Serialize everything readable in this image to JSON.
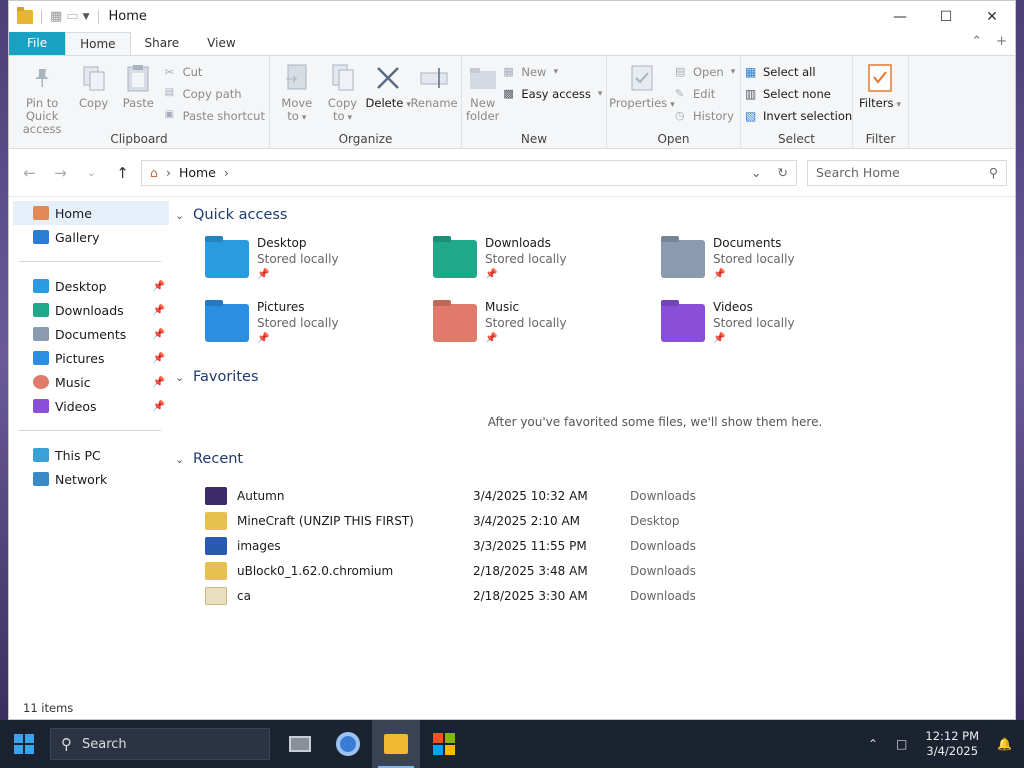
{
  "window": {
    "title": "Home"
  },
  "ribbon_tabs": {
    "file": "File",
    "home": "Home",
    "share": "Share",
    "view": "View"
  },
  "ribbon": {
    "clipboard": {
      "label": "Clipboard",
      "pin": "Pin to Quick access",
      "copy": "Copy",
      "paste": "Paste",
      "cut": "Cut",
      "copy_path": "Copy path",
      "paste_shortcut": "Paste shortcut"
    },
    "organize": {
      "label": "Organize",
      "move_to": "Move to",
      "copy_to": "Copy to",
      "delete": "Delete",
      "rename": "Rename"
    },
    "new": {
      "label": "New",
      "new_folder": "New folder",
      "new_item": "New",
      "easy_access": "Easy access"
    },
    "open": {
      "label": "Open",
      "properties": "Properties",
      "open": "Open",
      "edit": "Edit",
      "history": "History"
    },
    "select": {
      "label": "Select",
      "select_all": "Select all",
      "select_none": "Select none",
      "invert": "Invert selection"
    },
    "filter": {
      "label": "Filter",
      "filters": "Filters"
    }
  },
  "address": {
    "path": "Home",
    "search_placeholder": "Search Home"
  },
  "sidebar": {
    "top": [
      {
        "label": "Home",
        "icon": "home-icon"
      },
      {
        "label": "Gallery",
        "icon": "gallery-icon"
      }
    ],
    "pinned": [
      {
        "label": "Desktop",
        "icon": "desktop-icon"
      },
      {
        "label": "Downloads",
        "icon": "downloads-icon"
      },
      {
        "label": "Documents",
        "icon": "documents-icon"
      },
      {
        "label": "Pictures",
        "icon": "pictures-icon"
      },
      {
        "label": "Music",
        "icon": "music-icon"
      },
      {
        "label": "Videos",
        "icon": "videos-icon"
      }
    ],
    "bottom": [
      {
        "label": "This PC",
        "icon": "pc-icon"
      },
      {
        "label": "Network",
        "icon": "network-icon"
      }
    ]
  },
  "quick_access": {
    "heading": "Quick access",
    "items": [
      {
        "name": "Desktop",
        "sub": "Stored locally",
        "color": "#2b9be0"
      },
      {
        "name": "Downloads",
        "sub": "Stored locally",
        "color": "#1fa88a"
      },
      {
        "name": "Documents",
        "sub": "Stored locally",
        "color": "#8a9bb0"
      },
      {
        "name": "Pictures",
        "sub": "Stored locally",
        "color": "#2b8ee0"
      },
      {
        "name": "Music",
        "sub": "Stored locally",
        "color": "#e07a6a"
      },
      {
        "name": "Videos",
        "sub": "Stored locally",
        "color": "#8a4fd8"
      }
    ]
  },
  "favorites": {
    "heading": "Favorites",
    "empty": "After you've favorited some files, we'll show them here."
  },
  "recent": {
    "heading": "Recent",
    "items": [
      {
        "name": "Autumn",
        "date": "3/4/2025 10:32 AM",
        "location": "Downloads",
        "color": "#3a2a6a"
      },
      {
        "name": "MineCraft (UNZIP THIS FIRST)",
        "date": "3/4/2025 2:10 AM",
        "location": "Desktop",
        "color": "#e8c050"
      },
      {
        "name": "images",
        "date": "3/3/2025 11:55 PM",
        "location": "Downloads",
        "color": "#2a5ab0"
      },
      {
        "name": "uBlock0_1.62.0.chromium",
        "date": "2/18/2025 3:48 AM",
        "location": "Downloads",
        "color": "#e8c050"
      },
      {
        "name": "ca",
        "date": "2/18/2025 3:30 AM",
        "location": "Downloads",
        "color": "#e8e0c0"
      }
    ]
  },
  "status": {
    "items": "11 items"
  },
  "taskbar": {
    "search": "Search",
    "time": "12:12 PM",
    "date": "3/4/2025"
  }
}
